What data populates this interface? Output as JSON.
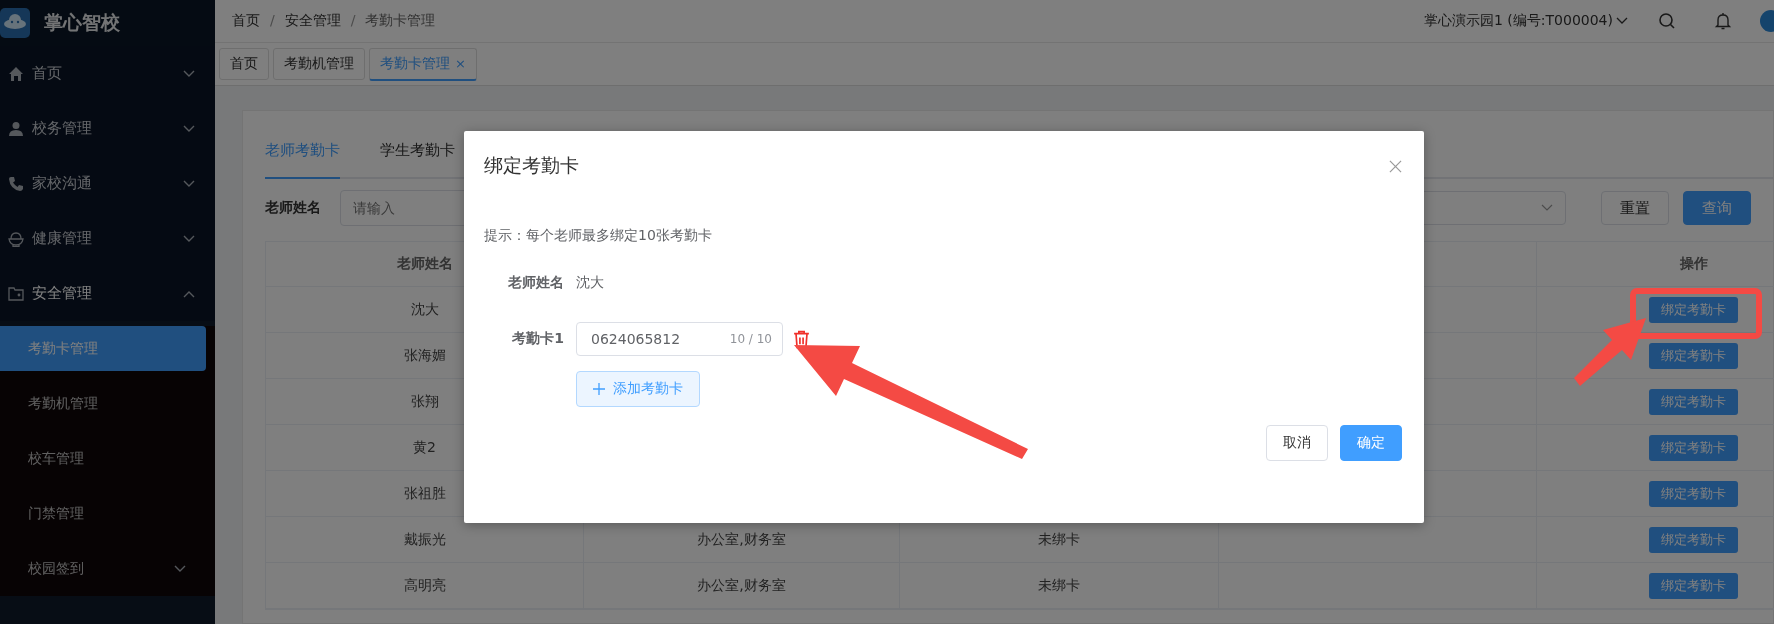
{
  "brand": {
    "name": "掌心智校"
  },
  "sidebar": {
    "items": [
      {
        "label": "首页",
        "expanded": false
      },
      {
        "label": "校务管理",
        "expanded": false
      },
      {
        "label": "家校沟通",
        "expanded": false
      },
      {
        "label": "健康管理",
        "expanded": false
      },
      {
        "label": "安全管理",
        "expanded": true,
        "children": [
          {
            "label": "考勤卡管理",
            "kind": "link",
            "selected": true
          },
          {
            "label": "考勤机管理",
            "kind": "link",
            "selected": false
          },
          {
            "label": "校车管理",
            "kind": "link",
            "selected": false
          },
          {
            "label": "门禁管理",
            "kind": "link",
            "selected": false
          },
          {
            "label": "校园签到",
            "kind": "group",
            "selected": false,
            "expanded": false
          }
        ]
      }
    ]
  },
  "header": {
    "breadcrumb": [
      {
        "label": "首页"
      },
      {
        "separator": "/",
        "label": "安全管理"
      },
      {
        "separator": "/",
        "label": "考勤卡管理"
      }
    ],
    "school": "掌心演示园1 (编号:T000004)"
  },
  "tags": [
    {
      "label": "首页",
      "selected": false
    },
    {
      "label": "考勤机管理",
      "selected": false
    },
    {
      "label": "考勤卡管理",
      "selected": true,
      "close": "×"
    }
  ],
  "page": {
    "tabs": [
      {
        "label": "老师考勤卡",
        "selected": true
      },
      {
        "label": "学生考勤卡",
        "selected": false
      }
    ],
    "filter": {
      "label": "老师姓名",
      "placeholder": "请输入"
    },
    "buttons": [
      {
        "label": "重置",
        "kind": "default"
      },
      {
        "label": "查询",
        "kind": "primary"
      }
    ],
    "table": {
      "columns": {
        "column_1": "老师姓名",
        "column_5": "操作"
      },
      "rows": [
        {
          "name": "沈大",
          "action": "绑定考勤卡"
        },
        {
          "name": "张海媚",
          "action": "绑定考勤卡"
        },
        {
          "name": "张翔",
          "action": "绑定考勤卡"
        },
        {
          "name": "黄2",
          "action": "绑定考勤卡"
        },
        {
          "name": "张祖胜",
          "action": "绑定考勤卡"
        },
        {
          "name": "戴振光",
          "column_2": "办公室,财务室",
          "column_3": "未绑卡",
          "action": "绑定考勤卡"
        },
        {
          "name": "高明亮",
          "column_2": "办公室,财务室",
          "column_3": "未绑卡",
          "action": "绑定考勤卡"
        }
      ]
    }
  },
  "dialog": {
    "title": "绑定考勤卡",
    "hint": "提示：每个老师最多绑定10张考勤卡",
    "fields": [
      {
        "kind": "text",
        "label": "老师姓名",
        "value": "沈大"
      },
      {
        "kind": "card",
        "label": "考勤卡1",
        "value": "0624065812",
        "counter": "10 / 10"
      }
    ],
    "add_button": "添加考勤卡",
    "buttons": [
      {
        "label": "取消",
        "kind": "default"
      },
      {
        "label": "确定",
        "kind": "primary"
      }
    ]
  }
}
